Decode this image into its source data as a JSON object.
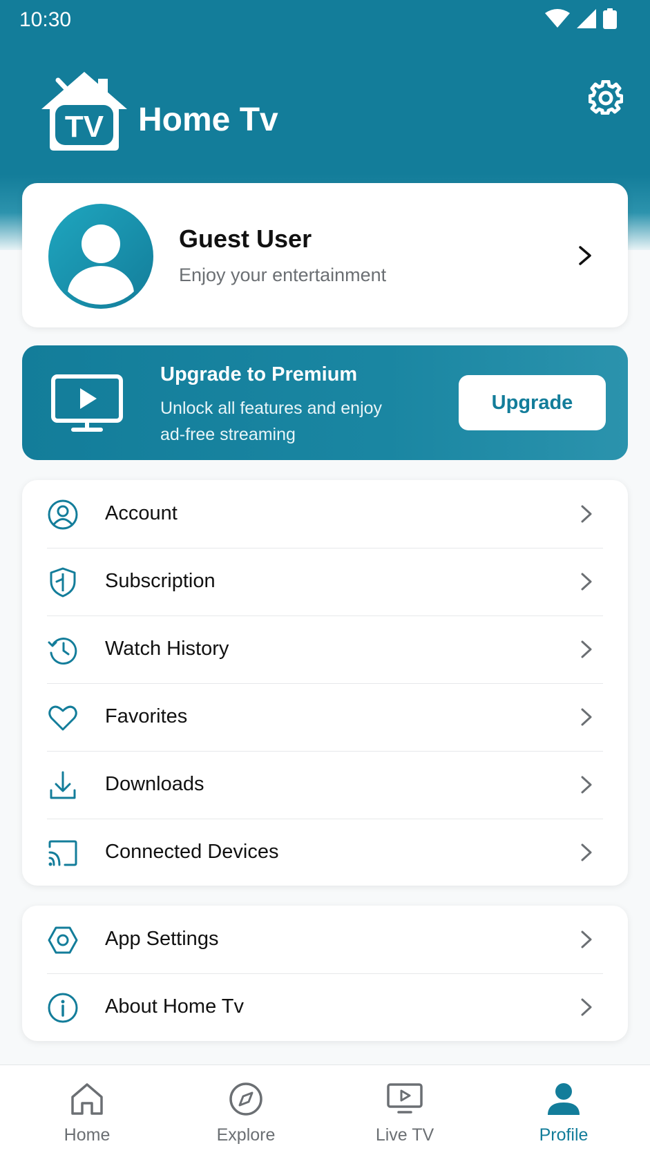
{
  "status_bar": {
    "time": "10:30"
  },
  "header": {
    "app_title": "Home Tv",
    "logo_text": "TV"
  },
  "profile": {
    "name": "Guest User",
    "subtitle": "Enjoy your entertainment"
  },
  "premium": {
    "title": "Upgrade to Premium",
    "description": "Unlock all features and enjoy ad-free streaming",
    "button_label": "Upgrade"
  },
  "menu": {
    "items": [
      {
        "label": "Account",
        "icon": "account-icon"
      },
      {
        "label": "Subscription",
        "icon": "shield-icon"
      },
      {
        "label": "Watch History",
        "icon": "history-icon"
      },
      {
        "label": "Favorites",
        "icon": "heart-icon"
      },
      {
        "label": "Downloads",
        "icon": "download-icon"
      },
      {
        "label": "Connected Devices",
        "icon": "cast-icon"
      }
    ],
    "secondary": [
      {
        "label": "App Settings",
        "icon": "hexagon-settings-icon"
      },
      {
        "label": "About Home Tv",
        "icon": "info-icon"
      }
    ]
  },
  "bottom_nav": {
    "items": [
      {
        "label": "Home",
        "icon": "home-icon"
      },
      {
        "label": "Explore",
        "icon": "compass-icon"
      },
      {
        "label": "Live TV",
        "icon": "tv-play-icon"
      },
      {
        "label": "Profile",
        "icon": "person-icon"
      }
    ],
    "active": "Profile"
  },
  "colors": {
    "primary": "#137d9a",
    "muted": "#6b6f73",
    "background": "#f7f9fa"
  }
}
